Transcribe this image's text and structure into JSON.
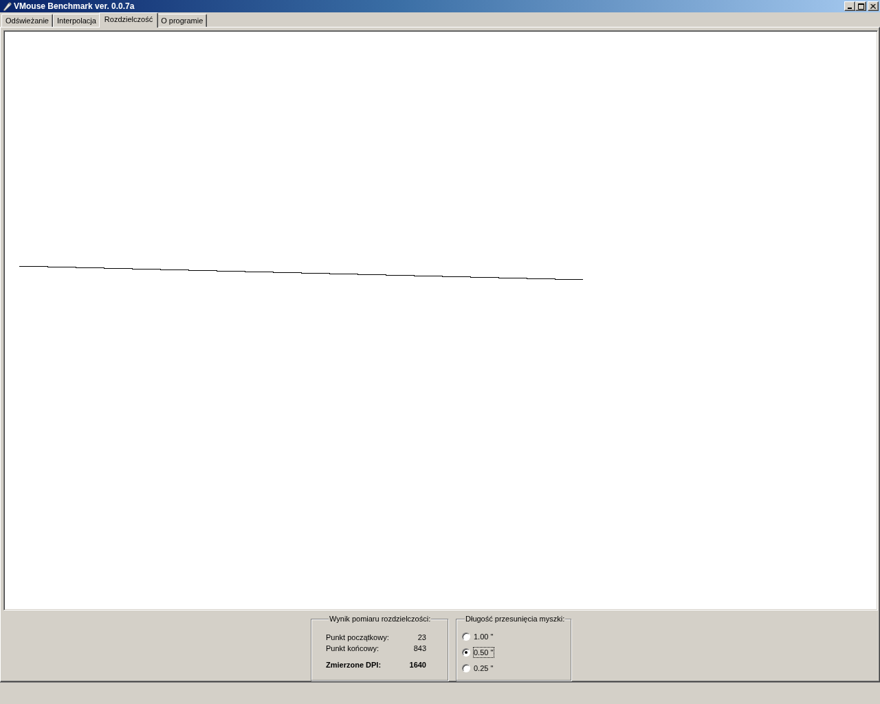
{
  "window": {
    "title": "VMouse Benchmark ver. 0.0.7a"
  },
  "tabs": [
    {
      "label": "Odświeżanie",
      "selected": false
    },
    {
      "label": "Interpolacja",
      "selected": false
    },
    {
      "label": "Rozdzielczość",
      "selected": true
    },
    {
      "label": "O programie",
      "selected": false
    }
  ],
  "results": {
    "title": "Wynik pomiaru rozdzielczości:",
    "rows": [
      {
        "label": "Punkt początkowy:",
        "value": "23",
        "kind": "normal"
      },
      {
        "label": "Punkt końcowy:",
        "value": "843",
        "kind": "normal"
      },
      {
        "label": "Zmierzone DPI:",
        "value": "1640",
        "kind": "total"
      }
    ]
  },
  "distance": {
    "title": "Długość przesunięcia myszki:",
    "options": [
      {
        "label": "1.00 \"",
        "selected": false,
        "focused": false
      },
      {
        "label": "0.50 \"",
        "selected": true,
        "focused": true
      },
      {
        "label": "0.25 \"",
        "selected": false,
        "focused": false
      }
    ]
  }
}
